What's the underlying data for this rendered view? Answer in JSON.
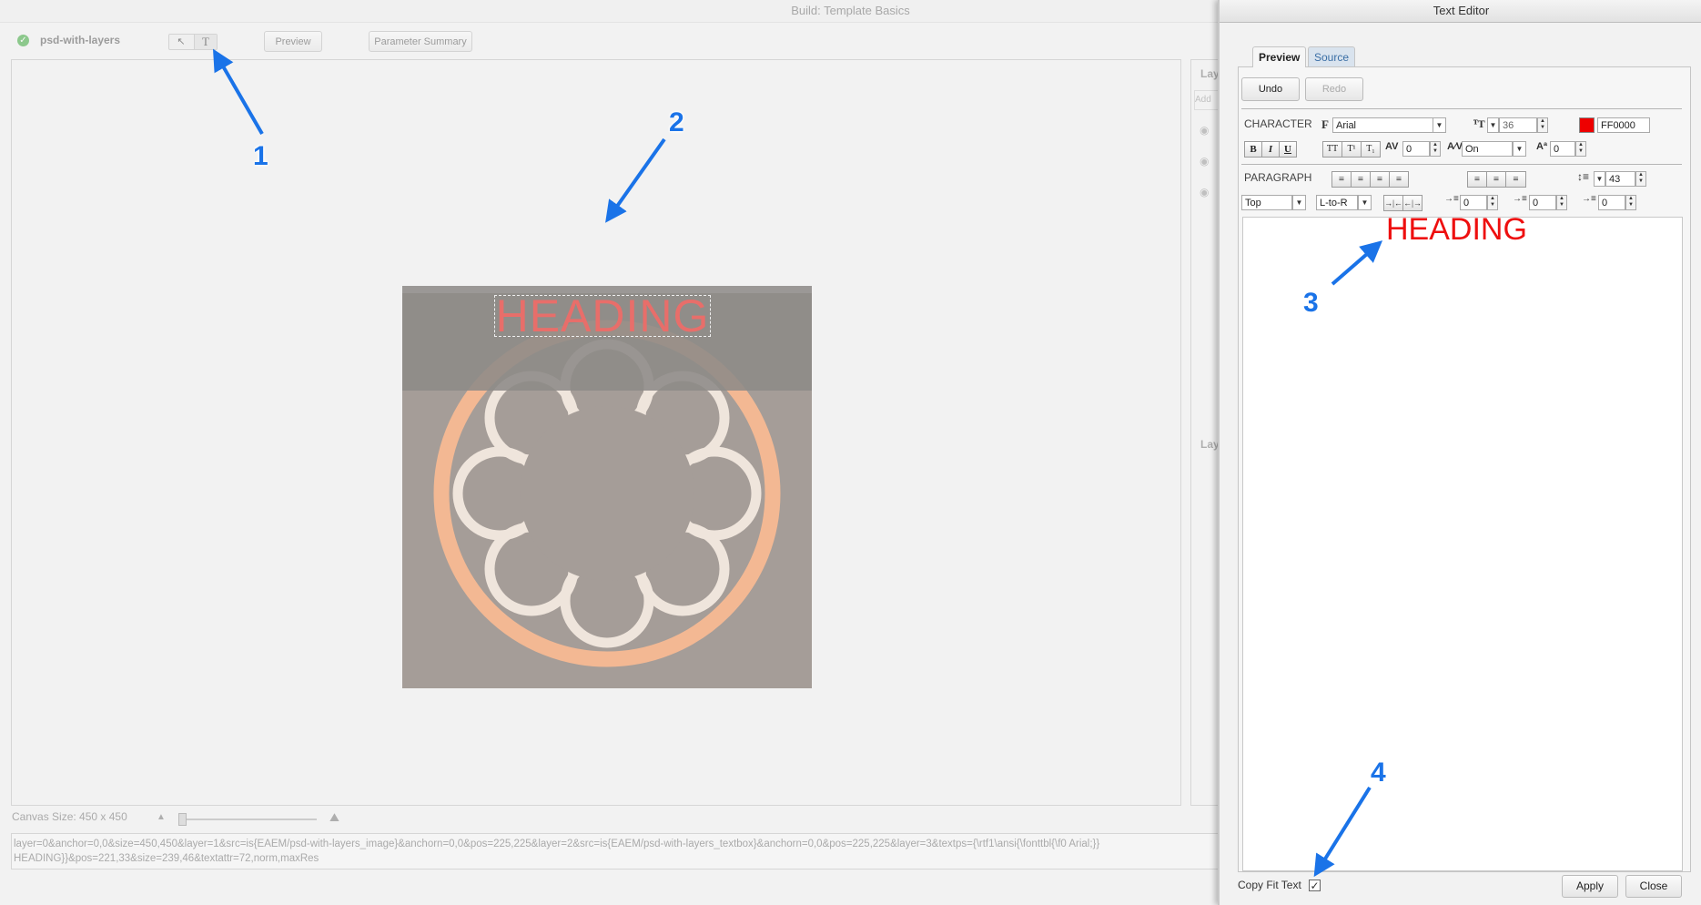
{
  "window": {
    "title": "Build: Template Basics"
  },
  "toolbar": {
    "status_label": "psd-with-layers",
    "preview_label": "Preview",
    "param_summary_label": "Parameter Summary"
  },
  "canvas": {
    "heading_text": "HEADING",
    "size_label": "Canvas Size: 450 x 450",
    "url": "layer=0&anchor=0,0&size=450,450&layer=1&src=is{EAEM/psd-with-layers_image}&anchorn=0,0&pos=225,225&layer=2&src=is{EAEM/psd-with-layers_textbox}&anchorn=0,0&pos=225,225&layer=3&textps={\\rtf1\\ansi{\\fonttbl{\\f0 Arial;}}\nHEADING}}&pos=221,33&size=239,46&textattr=72,norm,maxRes"
  },
  "side_panel": {
    "header1": "Lay",
    "add_label": "Add",
    "header2": "Lay"
  },
  "editor": {
    "title": "Text Editor",
    "tabs": [
      "Preview",
      "Source"
    ],
    "undo": "Undo",
    "redo": "Redo",
    "character_label": "CHARACTER",
    "font": "Arial",
    "font_size": "36",
    "color_hex": "FF0000",
    "color": "#ee0000",
    "tracking": "0",
    "kerning": "On",
    "baseline": "0",
    "paragraph_label": "PARAGRAPH",
    "leading": "43",
    "vertical_align": "Top",
    "direction": "L-to-R",
    "indent_first": "0",
    "indent_left": "0",
    "indent_right": "0",
    "preview_text": "HEADING",
    "copy_fit_label": "Copy Fit Text",
    "copy_fit_checked": true,
    "apply": "Apply",
    "close": "Close"
  },
  "annotations": [
    "1",
    "2",
    "3",
    "4"
  ]
}
